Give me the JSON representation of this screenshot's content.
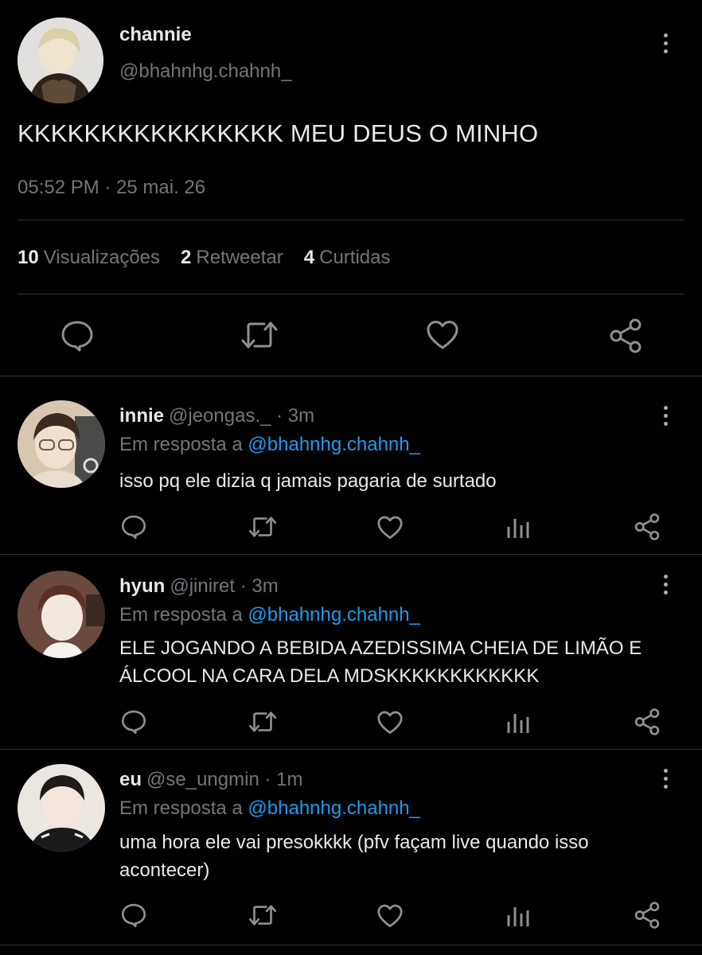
{
  "main_tweet": {
    "author_name": "channie",
    "author_handle": "@bhahnhg.chahnh_",
    "text": "KKKKKKKKKKKKKKKK MEU DEUS O MINHO",
    "timestamp": "05:52 PM · 25 mai. 26",
    "stats": [
      {
        "count": "10",
        "label": "Visualizações"
      },
      {
        "count": "2",
        "label": "Retweetar"
      },
      {
        "count": "4",
        "label": "Curtidas"
      }
    ],
    "actions": [
      "reply-icon",
      "retweet-icon",
      "like-icon",
      "share-icon"
    ]
  },
  "replies": [
    {
      "name": "innie",
      "handle": "@jeongas._",
      "time": "· 3m",
      "reply_to_label": "Em resposta a",
      "reply_to_handle": "@bhahnhg.chahnh_",
      "text": "isso pq ele dizia q jamais pagaria de surtado",
      "avatar_colors": [
        "#c9b59c",
        "#3a2e25"
      ]
    },
    {
      "name": "hyun",
      "handle": "@jiniret",
      "time": "· 3m",
      "reply_to_label": "Em resposta a",
      "reply_to_handle": "@bhahnhg.chahnh_",
      "text": "ELE JOGANDO A BEBIDA AZEDISSIMA CHEIA DE LIMÃO E ÁLCOOL NA CARA DELA MDSKKKKKKKKKKKK",
      "avatar_colors": [
        "#e8dcd2",
        "#5a2a22"
      ]
    },
    {
      "name": "eu",
      "handle": "@se_ungmin",
      "time": "· 1m",
      "reply_to_label": "Em resposta a",
      "reply_to_handle": "@bhahnhg.chahnh_",
      "text": "uma hora ele vai presokkkk (pfv façam live quando isso acontecer)",
      "avatar_colors": [
        "#efe9e4",
        "#1c1c1c"
      ]
    }
  ],
  "colors": {
    "background": "#000000",
    "text_primary": "#e7e9ea",
    "text_secondary": "#71767b",
    "link": "#1d9bf0",
    "divider": "#2f3336",
    "icon": "#8b9095"
  }
}
